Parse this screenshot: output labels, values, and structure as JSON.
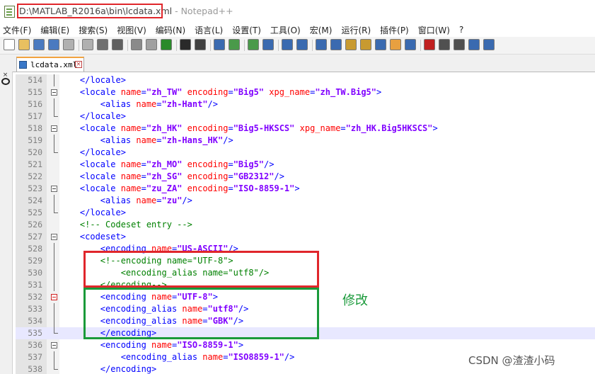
{
  "window": {
    "path": "D:\\MATLAB_R2016a\\bin\\lcdata.xml",
    "app_suffix": " - Notepad++"
  },
  "menu": [
    "文件(F)",
    "编辑(E)",
    "搜索(S)",
    "视图(V)",
    "编码(N)",
    "语言(L)",
    "设置(T)",
    "工具(O)",
    "宏(M)",
    "运行(R)",
    "插件(P)",
    "窗口(W)",
    "?"
  ],
  "toolbar_icons": [
    "new-icon",
    "open-icon",
    "save-icon",
    "save-all-icon",
    "close-icon",
    "close-all-icon",
    "print-icon",
    "cut-icon",
    "copy-icon",
    "paste-icon",
    "undo-icon",
    "redo-icon",
    "find-icon",
    "replace-icon",
    "zoom-in-icon",
    "zoom-out-icon",
    "sync-v-icon",
    "sync-h-icon",
    "wrap-icon",
    "all-chars-icon",
    "indent-guide-icon",
    "udl-icon",
    "doc-map-icon",
    "func-list-icon",
    "folder-workspace-icon",
    "monitor-icon",
    "record-icon",
    "stop-icon",
    "play-icon",
    "play-multi-icon",
    "save-macro-icon"
  ],
  "tab": {
    "label": "lcdata.xml"
  },
  "editor": {
    "lines": [
      {
        "num": "514",
        "fold": "line",
        "tokens": [
          [
            "p",
            "    "
          ],
          [
            "tag",
            "</locale>"
          ]
        ]
      },
      {
        "num": "515",
        "fold": "open",
        "tokens": [
          [
            "p",
            "    "
          ],
          [
            "tag",
            "<locale "
          ],
          [
            "attr",
            "name"
          ],
          [
            "tag",
            "="
          ],
          [
            "val",
            "\"zh_TW\""
          ],
          [
            "attr",
            " encoding"
          ],
          [
            "tag",
            "="
          ],
          [
            "val",
            "\"Big5\""
          ],
          [
            "attr",
            " xpg_name"
          ],
          [
            "tag",
            "="
          ],
          [
            "val",
            "\"zh_TW.Big5\""
          ],
          [
            "tag",
            ">"
          ]
        ]
      },
      {
        "num": "516",
        "fold": "line",
        "tokens": [
          [
            "p",
            "        "
          ],
          [
            "tag",
            "<alias "
          ],
          [
            "attr",
            "name"
          ],
          [
            "tag",
            "="
          ],
          [
            "val",
            "\"zh-Hant\""
          ],
          [
            "tag",
            "/>"
          ]
        ]
      },
      {
        "num": "517",
        "fold": "end",
        "tokens": [
          [
            "p",
            "    "
          ],
          [
            "tag",
            "</locale>"
          ]
        ]
      },
      {
        "num": "518",
        "fold": "open",
        "tokens": [
          [
            "p",
            "    "
          ],
          [
            "tag",
            "<locale "
          ],
          [
            "attr",
            "name"
          ],
          [
            "tag",
            "="
          ],
          [
            "val",
            "\"zh_HK\""
          ],
          [
            "attr",
            " encoding"
          ],
          [
            "tag",
            "="
          ],
          [
            "val",
            "\"Big5-HKSCS\""
          ],
          [
            "attr",
            " xpg_name"
          ],
          [
            "tag",
            "="
          ],
          [
            "val",
            "\"zh_HK.Big5HKSCS\""
          ],
          [
            "tag",
            ">"
          ]
        ]
      },
      {
        "num": "519",
        "fold": "line",
        "tokens": [
          [
            "p",
            "        "
          ],
          [
            "tag",
            "<alias "
          ],
          [
            "attr",
            "name"
          ],
          [
            "tag",
            "="
          ],
          [
            "val",
            "\"zh-Hans_HK\""
          ],
          [
            "tag",
            "/>"
          ]
        ]
      },
      {
        "num": "520",
        "fold": "end",
        "tokens": [
          [
            "p",
            "    "
          ],
          [
            "tag",
            "</locale>"
          ]
        ]
      },
      {
        "num": "521",
        "fold": "none",
        "tokens": [
          [
            "p",
            "    "
          ],
          [
            "tag",
            "<locale "
          ],
          [
            "attr",
            "name"
          ],
          [
            "tag",
            "="
          ],
          [
            "val",
            "\"zh_MO\""
          ],
          [
            "attr",
            " encoding"
          ],
          [
            "tag",
            "="
          ],
          [
            "val",
            "\"Big5\""
          ],
          [
            "tag",
            "/>"
          ]
        ]
      },
      {
        "num": "522",
        "fold": "none",
        "tokens": [
          [
            "p",
            "    "
          ],
          [
            "tag",
            "<locale "
          ],
          [
            "attr",
            "name"
          ],
          [
            "tag",
            "="
          ],
          [
            "val",
            "\"zh_SG\""
          ],
          [
            "attr",
            " encoding"
          ],
          [
            "tag",
            "="
          ],
          [
            "val",
            "\"GB2312\""
          ],
          [
            "tag",
            "/>"
          ]
        ]
      },
      {
        "num": "523",
        "fold": "open",
        "tokens": [
          [
            "p",
            "    "
          ],
          [
            "tag",
            "<locale "
          ],
          [
            "attr",
            "name"
          ],
          [
            "tag",
            "="
          ],
          [
            "val",
            "\"zu_ZA\""
          ],
          [
            "attr",
            " encoding"
          ],
          [
            "tag",
            "="
          ],
          [
            "val",
            "\"ISO-8859-1\""
          ],
          [
            "tag",
            ">"
          ]
        ]
      },
      {
        "num": "524",
        "fold": "line",
        "tokens": [
          [
            "p",
            "        "
          ],
          [
            "tag",
            "<alias "
          ],
          [
            "attr",
            "name"
          ],
          [
            "tag",
            "="
          ],
          [
            "val",
            "\"zu\""
          ],
          [
            "tag",
            "/>"
          ]
        ]
      },
      {
        "num": "525",
        "fold": "end",
        "tokens": [
          [
            "p",
            "    "
          ],
          [
            "tag",
            "</locale>"
          ]
        ]
      },
      {
        "num": "526",
        "fold": "none",
        "tokens": [
          [
            "p",
            "    "
          ],
          [
            "comment",
            "<!-- Codeset entry -->"
          ]
        ]
      },
      {
        "num": "527",
        "fold": "open",
        "tokens": [
          [
            "p",
            "    "
          ],
          [
            "tag",
            "<codeset>"
          ]
        ]
      },
      {
        "num": "528",
        "fold": "line",
        "tokens": [
          [
            "p",
            "        "
          ],
          [
            "tag",
            "<encoding "
          ],
          [
            "attr",
            "name"
          ],
          [
            "tag",
            "="
          ],
          [
            "val",
            "\"US-ASCII\""
          ],
          [
            "tag",
            "/>"
          ]
        ]
      },
      {
        "num": "529",
        "fold": "line",
        "tokens": [
          [
            "p",
            "        "
          ],
          [
            "comment",
            "<!--encoding name=\"UTF-8\">"
          ]
        ]
      },
      {
        "num": "530",
        "fold": "line",
        "tokens": [
          [
            "p",
            "            "
          ],
          [
            "comment",
            "<encoding_alias name=\"utf8\"/>"
          ]
        ]
      },
      {
        "num": "531",
        "fold": "line",
        "tokens": [
          [
            "p",
            "        "
          ],
          [
            "comment",
            "</encoding-->"
          ]
        ]
      },
      {
        "num": "532",
        "fold": "open-red",
        "tokens": [
          [
            "p",
            "        "
          ],
          [
            "tag",
            "<encoding "
          ],
          [
            "attr",
            "name"
          ],
          [
            "tag",
            "="
          ],
          [
            "val",
            "\"UTF-8\""
          ],
          [
            "tag",
            ">"
          ]
        ]
      },
      {
        "num": "533",
        "fold": "line",
        "tokens": [
          [
            "p",
            "        "
          ],
          [
            "tag",
            "<encoding_alias "
          ],
          [
            "attr",
            "name"
          ],
          [
            "tag",
            "="
          ],
          [
            "val",
            "\"utf8\""
          ],
          [
            "tag",
            "/>"
          ]
        ]
      },
      {
        "num": "534",
        "fold": "line",
        "tokens": [
          [
            "p",
            "        "
          ],
          [
            "tag",
            "<encoding_alias "
          ],
          [
            "attr",
            "name"
          ],
          [
            "tag",
            "="
          ],
          [
            "val",
            "\"GBK\""
          ],
          [
            "tag",
            "/>"
          ]
        ]
      },
      {
        "num": "535",
        "fold": "end",
        "current": true,
        "tokens": [
          [
            "p",
            "        "
          ],
          [
            "tag",
            "</encoding>"
          ]
        ]
      },
      {
        "num": "536",
        "fold": "open",
        "tokens": [
          [
            "p",
            "        "
          ],
          [
            "tag",
            "<encoding "
          ],
          [
            "attr",
            "name"
          ],
          [
            "tag",
            "="
          ],
          [
            "val",
            "\"ISO-8859-1\""
          ],
          [
            "tag",
            ">"
          ]
        ]
      },
      {
        "num": "537",
        "fold": "line",
        "tokens": [
          [
            "p",
            "            "
          ],
          [
            "tag",
            "<encoding_alias "
          ],
          [
            "attr",
            "name"
          ],
          [
            "tag",
            "="
          ],
          [
            "val",
            "\"ISO8859-1\""
          ],
          [
            "tag",
            "/>"
          ]
        ]
      },
      {
        "num": "538",
        "fold": "end",
        "tokens": [
          [
            "p",
            "        "
          ],
          [
            "tag",
            "</encoding>"
          ]
        ]
      }
    ]
  },
  "annotation": {
    "label": "修改",
    "color": "#1a9a3a",
    "old_box_color": "#e0262b"
  },
  "watermark": "CSDN @渣渣小码"
}
